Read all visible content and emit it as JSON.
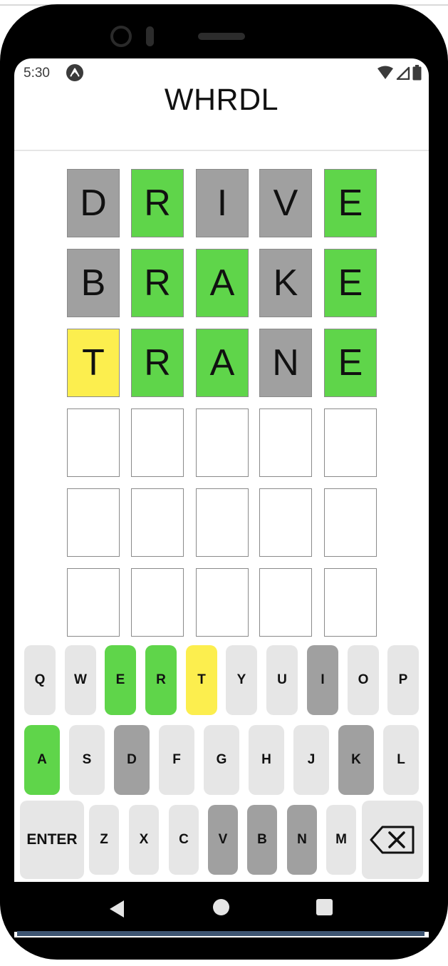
{
  "status_bar": {
    "time": "5:30"
  },
  "app": {
    "title": "WHRDL"
  },
  "board": {
    "rows": [
      {
        "tiles": [
          {
            "letter": "D",
            "state": "gray"
          },
          {
            "letter": "R",
            "state": "green"
          },
          {
            "letter": "I",
            "state": "gray"
          },
          {
            "letter": "V",
            "state": "gray"
          },
          {
            "letter": "E",
            "state": "green"
          }
        ]
      },
      {
        "tiles": [
          {
            "letter": "B",
            "state": "gray"
          },
          {
            "letter": "R",
            "state": "green"
          },
          {
            "letter": "A",
            "state": "green"
          },
          {
            "letter": "K",
            "state": "gray"
          },
          {
            "letter": "E",
            "state": "green"
          }
        ]
      },
      {
        "tiles": [
          {
            "letter": "T",
            "state": "yellow"
          },
          {
            "letter": "R",
            "state": "green"
          },
          {
            "letter": "A",
            "state": "green"
          },
          {
            "letter": "N",
            "state": "gray"
          },
          {
            "letter": "E",
            "state": "green"
          }
        ]
      },
      {
        "tiles": [
          {
            "letter": "",
            "state": "empty"
          },
          {
            "letter": "",
            "state": "empty"
          },
          {
            "letter": "",
            "state": "empty"
          },
          {
            "letter": "",
            "state": "empty"
          },
          {
            "letter": "",
            "state": "empty"
          }
        ]
      },
      {
        "tiles": [
          {
            "letter": "",
            "state": "empty"
          },
          {
            "letter": "",
            "state": "empty"
          },
          {
            "letter": "",
            "state": "empty"
          },
          {
            "letter": "",
            "state": "empty"
          },
          {
            "letter": "",
            "state": "empty"
          }
        ]
      },
      {
        "tiles": [
          {
            "letter": "",
            "state": "empty"
          },
          {
            "letter": "",
            "state": "empty"
          },
          {
            "letter": "",
            "state": "empty"
          },
          {
            "letter": "",
            "state": "empty"
          },
          {
            "letter": "",
            "state": "empty"
          }
        ]
      }
    ]
  },
  "keyboard": {
    "rows": [
      [
        {
          "label": "Q",
          "state": "default"
        },
        {
          "label": "W",
          "state": "default"
        },
        {
          "label": "E",
          "state": "green"
        },
        {
          "label": "R",
          "state": "green"
        },
        {
          "label": "T",
          "state": "yellow"
        },
        {
          "label": "Y",
          "state": "default"
        },
        {
          "label": "U",
          "state": "default"
        },
        {
          "label": "I",
          "state": "gray"
        },
        {
          "label": "O",
          "state": "default"
        },
        {
          "label": "P",
          "state": "default"
        }
      ],
      [
        {
          "label": "A",
          "state": "green"
        },
        {
          "label": "S",
          "state": "default"
        },
        {
          "label": "D",
          "state": "gray"
        },
        {
          "label": "F",
          "state": "default"
        },
        {
          "label": "G",
          "state": "default"
        },
        {
          "label": "H",
          "state": "default"
        },
        {
          "label": "J",
          "state": "default"
        },
        {
          "label": "K",
          "state": "gray"
        },
        {
          "label": "L",
          "state": "default"
        }
      ],
      [
        {
          "label": "ENTER",
          "state": "default"
        },
        {
          "label": "Z",
          "state": "default"
        },
        {
          "label": "X",
          "state": "default"
        },
        {
          "label": "C",
          "state": "default"
        },
        {
          "label": "V",
          "state": "gray"
        },
        {
          "label": "B",
          "state": "gray"
        },
        {
          "label": "N",
          "state": "gray"
        },
        {
          "label": "M",
          "state": "default"
        },
        {
          "label": "",
          "icon": "backspace-icon",
          "state": "default"
        }
      ]
    ]
  },
  "colors": {
    "correct": "#5fd54a",
    "present": "#fcee4e",
    "absent": "#a0a0a0",
    "unused": "#e6e6e6"
  }
}
